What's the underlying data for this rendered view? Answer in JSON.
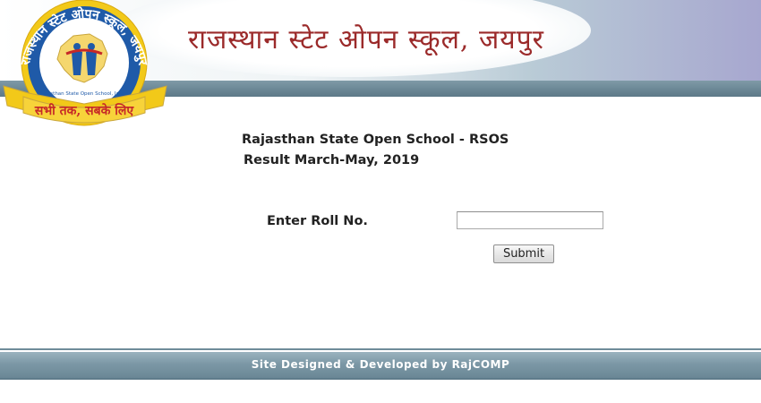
{
  "header": {
    "title": "राजस्थान स्टेट ओपन स्कूल, जयपुर",
    "logo": {
      "arc_text": "राजस्थान स्टेट ओपन स्कूल, जयपुर",
      "inner_text": "Rajasthan State Open School, Jaipur",
      "ribbon_text": "सभी तक, सबके लिए"
    }
  },
  "main": {
    "school_name": "Rajasthan State Open School - RSOS",
    "result_label": "Result March-May, 2019",
    "roll_label": "Enter Roll No.",
    "roll_value": "",
    "submit_label": "Submit"
  },
  "footer": {
    "text": "Site Designed & Developed by RajCOMP"
  },
  "colors": {
    "title_red": "#9b2a2a",
    "band": "#6d8997",
    "logo_blue": "#1f5aa8",
    "logo_yellow": "#f2c919",
    "logo_red": "#c62828"
  }
}
